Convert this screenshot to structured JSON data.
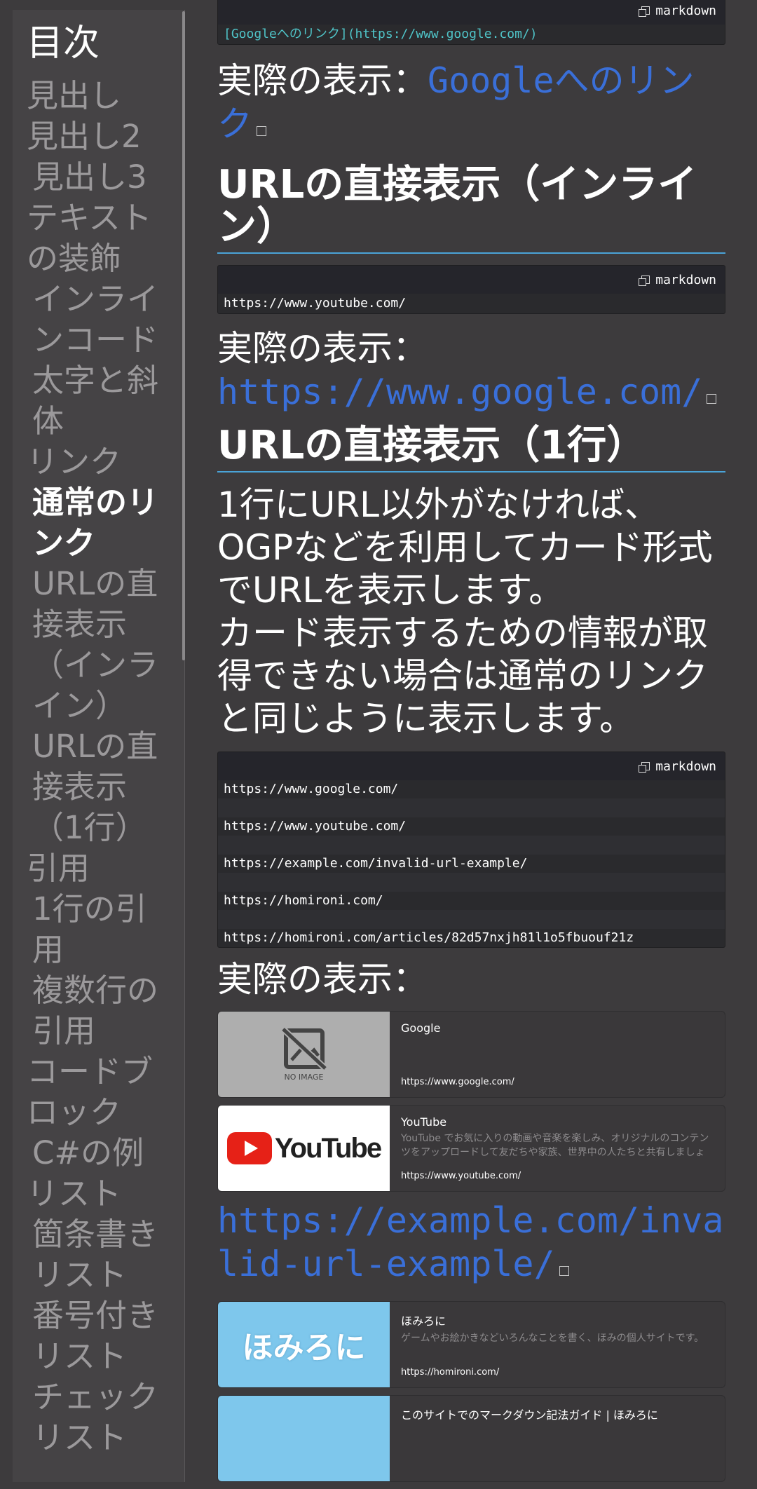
{
  "toc": {
    "title": "目次",
    "items": [
      {
        "label": "見出し",
        "level": 1
      },
      {
        "label": "見出し2",
        "level": 1
      },
      {
        "label": "見出し3",
        "level": 2
      },
      {
        "label": "テキストの装飾",
        "level": 1
      },
      {
        "label": "インラインコード",
        "level": 2
      },
      {
        "label": "太字と斜体",
        "level": 2
      },
      {
        "label": "リンク",
        "level": 1
      },
      {
        "label": "通常のリンク",
        "level": 2,
        "active": true
      },
      {
        "label": "URLの直接表示（インライン）",
        "level": 2
      },
      {
        "label": "URLの直接表示（1行）",
        "level": 2
      },
      {
        "label": "引用",
        "level": 1
      },
      {
        "label": "1行の引用",
        "level": 2
      },
      {
        "label": "複数行の引用",
        "level": 2
      },
      {
        "label": "コードブロック",
        "level": 1
      },
      {
        "label": "C#の例",
        "level": 2
      },
      {
        "label": "リスト",
        "level": 1
      },
      {
        "label": "箇条書きリスト",
        "level": 2
      },
      {
        "label": "番号付きリスト",
        "level": 2
      },
      {
        "label": "チェックリスト",
        "level": 2
      }
    ]
  },
  "main": {
    "code1": {
      "lang": "markdown",
      "line": "[Googleへのリンク](https://www.google.com/)"
    },
    "shown1": {
      "prefix": "実際の表示：",
      "link": "Googleへのリンク"
    },
    "heading_inline": "URLの直接表示（インライン）",
    "code2": {
      "lang": "markdown",
      "line": "https://www.youtube.com/"
    },
    "shown2": {
      "prefix": "実際の表示：",
      "link": "https://www.google.com/"
    },
    "heading_oneline": "URLの直接表示（1行）",
    "paragraph": "1行にURL以外がなければ、OGPなどを利用してカード形式でURLを表示します。\nカード表示するための情報が取得できない場合は通常のリンクと同じように表示します。",
    "code3": {
      "lang": "markdown",
      "lines": [
        "https://www.google.com/",
        "",
        "https://www.youtube.com/",
        "",
        "https://example.com/invalid-url-example/",
        "",
        "https://homironi.com/",
        "",
        "https://homironi.com/articles/82d57nxjh81l1o5fbuouf21z"
      ]
    },
    "shown3": {
      "prefix": "実際の表示："
    },
    "cards": [
      {
        "title": "Google",
        "desc": "",
        "url": "https://www.google.com/",
        "thumb": "no-image",
        "thumb_text": "NO IMAGE"
      },
      {
        "title": "YouTube",
        "desc": "YouTube でお気に入りの動画や音楽を楽しみ、オリジナルのコンテンツをアップロードして友だちや家族、世界中の人たちと共有しましょ",
        "url": "https://www.youtube.com/",
        "thumb": "youtube",
        "thumb_text": "YouTube"
      }
    ],
    "plain_link": "https://example.com/invalid-url-example/",
    "cards2": [
      {
        "title": "ほみろに",
        "desc": "ゲームやお絵かきなどいろんなことを書く、ほみの個人サイトです。",
        "url": "https://homironi.com/",
        "thumb": "homironi",
        "thumb_text": "ほみろに"
      },
      {
        "title": "このサイトでのマークダウン記法ガイド | ほみろに",
        "desc": "",
        "url": "",
        "thumb": "homironi",
        "thumb_text": ""
      }
    ]
  }
}
